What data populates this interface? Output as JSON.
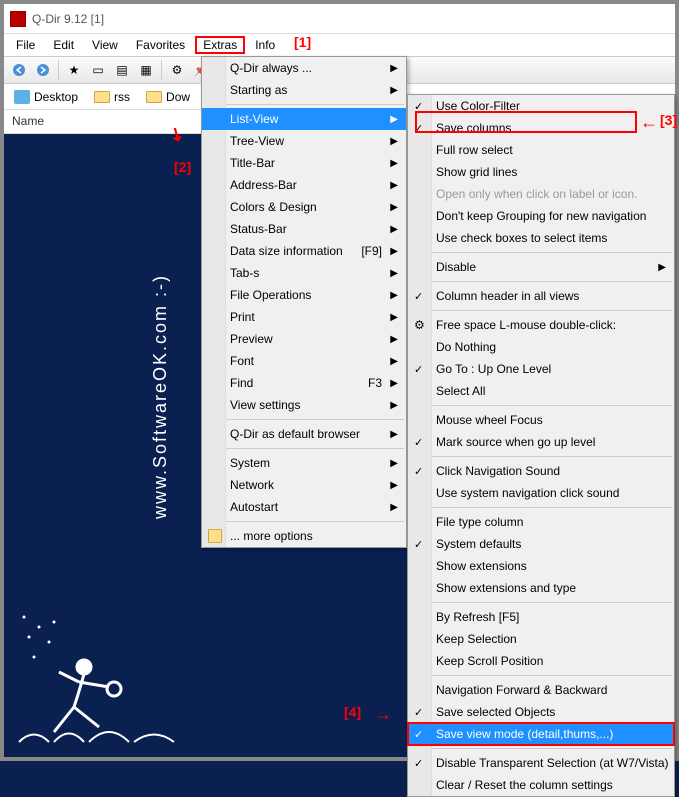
{
  "titlebar": {
    "text": "Q-Dir 9.12 [1]"
  },
  "menubar": {
    "items": [
      "File",
      "Edit",
      "View",
      "Favorites",
      "Extras",
      "Info"
    ]
  },
  "folderbar": {
    "items": [
      "Desktop",
      "rss",
      "Dow"
    ]
  },
  "column_header": "Name",
  "menu1": {
    "items": [
      {
        "label": "Q-Dir always ...",
        "arrow": true
      },
      {
        "label": "Starting as",
        "arrow": true
      },
      {
        "sep": true
      },
      {
        "label": "List-View",
        "arrow": true,
        "selected": true
      },
      {
        "label": "Tree-View",
        "arrow": true
      },
      {
        "label": "Title-Bar",
        "arrow": true
      },
      {
        "label": "Address-Bar",
        "arrow": true
      },
      {
        "label": "Colors & Design",
        "arrow": true
      },
      {
        "label": "Status-Bar",
        "arrow": true
      },
      {
        "label": "Data size information",
        "arrow": true,
        "shortcut": "[F9]"
      },
      {
        "label": "Tab-s",
        "arrow": true
      },
      {
        "label": "File Operations",
        "arrow": true
      },
      {
        "label": "Print",
        "arrow": true
      },
      {
        "label": "Preview",
        "arrow": true
      },
      {
        "label": "Font",
        "arrow": true
      },
      {
        "label": "Find",
        "arrow": true,
        "shortcut": "F3"
      },
      {
        "label": "View settings",
        "arrow": true
      },
      {
        "sep": true
      },
      {
        "label": "Q-Dir as default browser",
        "arrow": true
      },
      {
        "sep": true
      },
      {
        "label": "System",
        "arrow": true
      },
      {
        "label": "Network",
        "arrow": true
      },
      {
        "label": "Autostart",
        "arrow": true
      },
      {
        "sep": true
      },
      {
        "label": "... more options",
        "icon": "folder"
      }
    ]
  },
  "menu2": {
    "items": [
      {
        "label": "Use Color-Filter",
        "check": true
      },
      {
        "label": "Save columns",
        "check": true,
        "redbox": true
      },
      {
        "label": "Full row select"
      },
      {
        "label": "Show grid lines"
      },
      {
        "label": "Open only when click on label or icon.",
        "disabled": true
      },
      {
        "label": "Don't keep Grouping for new navigation"
      },
      {
        "label": "Use check boxes to select items"
      },
      {
        "sep": true
      },
      {
        "label": "Disable",
        "arrow": true
      },
      {
        "sep": true
      },
      {
        "label": "Column header in all views",
        "check": true
      },
      {
        "sep": true
      },
      {
        "label": "Free space L-mouse double-click:",
        "icon": "gear"
      },
      {
        "label": "Do Nothing"
      },
      {
        "label": "Go To : Up One Level",
        "check": true
      },
      {
        "label": "Select All"
      },
      {
        "sep": true
      },
      {
        "label": "Mouse wheel Focus"
      },
      {
        "label": "Mark source when go up level",
        "check": true
      },
      {
        "sep": true
      },
      {
        "label": "Click Navigation Sound",
        "check": true
      },
      {
        "label": "Use system navigation click sound"
      },
      {
        "sep": true
      },
      {
        "label": "File type column"
      },
      {
        "label": "System defaults",
        "check": true
      },
      {
        "label": "Show extensions"
      },
      {
        "label": "Show extensions and type"
      },
      {
        "sep": true
      },
      {
        "label": "By Refresh [F5]"
      },
      {
        "label": "Keep Selection"
      },
      {
        "label": "Keep Scroll Position"
      },
      {
        "sep": true
      },
      {
        "label": "Navigation Forward & Backward"
      },
      {
        "label": "Save selected Objects",
        "check": true
      },
      {
        "label": "Save view mode (detail,thums,...)",
        "check": true,
        "selected": true,
        "redbox2": true
      },
      {
        "sep": true
      },
      {
        "label": "Disable Transparent Selection (at W7/Vista)",
        "check": true
      },
      {
        "label": "Clear / Reset the column settings",
        "cut": true
      }
    ]
  },
  "annotations": {
    "a1": "[1]",
    "a2": "[2]",
    "a3": "[3]",
    "a4": "[4]"
  },
  "watermark": "www.SoftwareOK.com :-)"
}
